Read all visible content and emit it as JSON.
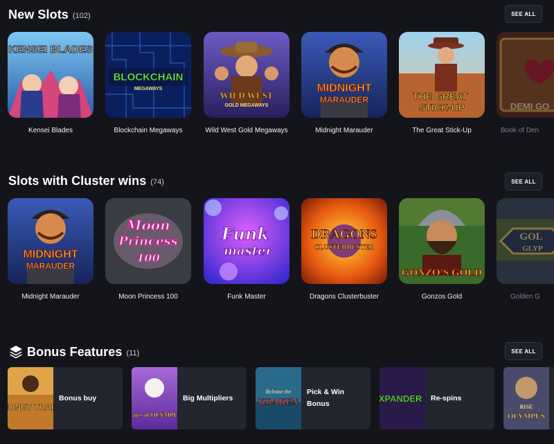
{
  "new_slots": {
    "title": "New Slots",
    "count": "(102)",
    "see_all": "SEE ALL",
    "games": [
      {
        "name": "Kensei Blades",
        "art": "KENSEI BLADES"
      },
      {
        "name": "Blockchain Megaways",
        "art": "BLOCKCHAIN",
        "art2": "MEGAWAYS"
      },
      {
        "name": "Wild West Gold Megaways",
        "art": "WILD WEST",
        "art2": "GOLD MEGAWAYS"
      },
      {
        "name": "Midnight Marauder",
        "art": "MIDNIGHT",
        "art2": "MARAUDER"
      },
      {
        "name": "The Great Stick-Up",
        "art": "THE GREAT",
        "art2": "STICK-UP"
      },
      {
        "name": "Book of Demi Gods",
        "label_visible": "Book of Den",
        "art": "DEMI GO"
      }
    ]
  },
  "cluster_slots": {
    "title": "Slots with Cluster wins",
    "count": "(74)",
    "see_all": "SEE ALL",
    "games": [
      {
        "name": "Midnight Marauder",
        "art": "MIDNIGHT",
        "art2": "MARAUDER"
      },
      {
        "name": "Moon Princess 100",
        "art": "Moon",
        "art2": "Princess",
        "art3": "100"
      },
      {
        "name": "Funk Master",
        "art": "Funk",
        "art2": "master"
      },
      {
        "name": "Dragons Clusterbuster",
        "art": "DRAGONS",
        "art2": "CLUSTERBUSTER"
      },
      {
        "name": "Gonzos Gold",
        "art": "GONZO'S GOLD"
      },
      {
        "name": "Golden",
        "label_visible": "Golden G",
        "art": "GOL",
        "art2": "GLYP"
      }
    ]
  },
  "bonus_features": {
    "title": "Bonus Features",
    "count": "(11)",
    "see_all": "SEE ALL",
    "icon": "layers-icon",
    "cards": [
      {
        "label": "Bonus buy",
        "art": "MONEY TRAIN"
      },
      {
        "label": "Big Multipliers",
        "art": "Gates of OLYMPUS"
      },
      {
        "label": "Pick & Win Bonus",
        "art": "KRAKEN",
        "art0": "Release the"
      },
      {
        "label": "Re-spins",
        "art": "XPANDER"
      },
      {
        "label": "",
        "art": "OLYMPUS",
        "art0": "RISE"
      }
    ]
  },
  "colors": {
    "background": "#14151b",
    "card": "#23262e",
    "faded_label": "#7b7d86"
  }
}
